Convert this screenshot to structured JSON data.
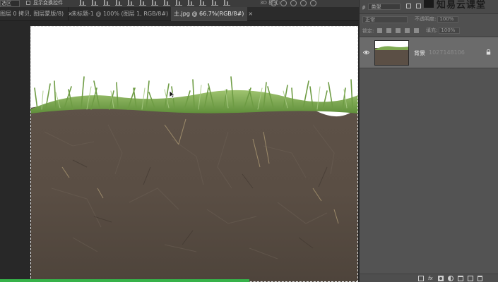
{
  "options_bar": {
    "preset_value": "选区",
    "show_transform_label": "显示变换控件",
    "mode_3d_label": "3D 模式:"
  },
  "tabs": [
    {
      "label": "图层 0 拷贝, 图层蒙版/8)",
      "close": "×",
      "active": false
    },
    {
      "label": "未标题-1 @ 100% (图层 1, RGB/8#)",
      "close": "×",
      "active": false
    },
    {
      "label": "土.jpg @ 66.7%(RGB/8#)",
      "close": "×",
      "active": true
    }
  ],
  "layers_panel": {
    "filter_label": "ρ",
    "filter_kind": "类型",
    "logo_text": "知易云课堂",
    "blend_mode": "正常",
    "opacity_label": "不透明度:",
    "opacity_value": "100%",
    "lock_label": "锁定:",
    "fill_label": "填充:",
    "fill_value": "100%",
    "layers": [
      {
        "name": "背景",
        "ghost_text": "1027148106",
        "visible": true,
        "locked": true
      }
    ],
    "footer_icons": [
      "link-icon",
      "fx-icon",
      "mask-icon",
      "adjustment-icon",
      "folder-icon",
      "new-layer-icon",
      "trash-icon"
    ]
  },
  "colors": {
    "panel_bg": "#535353",
    "canvas_bg": "#282828",
    "active_tab": "#424242",
    "selected_layer": "#6b6b6b",
    "progress_green": "#36b24a"
  },
  "progress": {
    "fraction": 0.5
  }
}
